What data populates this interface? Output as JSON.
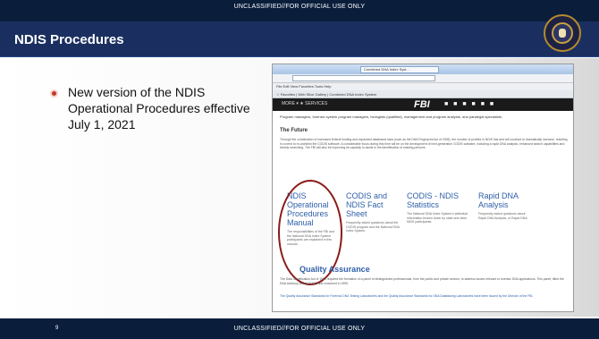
{
  "banner": {
    "classification_top": "UNCLASSIFIED//FOR OFFICIAL USE ONLY",
    "classification_bottom": "UNCLASSIFIED//FOR OFFICIAL USE ONLY"
  },
  "slide": {
    "title": "NDIS Procedures",
    "bullet": "New version of the NDIS Operational Procedures effective July 1, 2021",
    "page_number": "9"
  },
  "screenshot": {
    "browser_tab": "Combined DNA Index Syst...",
    "menu": "File   Edit   View   Favorites   Tools   Help",
    "favorites": "☆  Favorites   |   Web Slice Gallery   |   Combined DNA Index System",
    "fbi_nav": "MORE ▾  ★  SERVICES",
    "fbi_logo": "FBI",
    "fbi_icons": "■ ■ ■ ■ ■ ■",
    "intro_text": "Program managers, forensic system program managers, biologists (qualified), management and program analysts, and paralegal specialists.",
    "future_heading": "The Future",
    "future_text": "Through the combination of increased federal funding and expanded databases laws (such as the DNA Fingerprint Act of 2005), the number of profiles in NDIS has and will continue to dramatically increase, resulting in a need to re-architect the CODIS software. A considerable focus during this time will be on the development of next-generation CODIS software, including a rapid DNA analysis, enhanced search capabilities and kinship searching. The FBI will also be improving its capacity to assist in the identification of missing persons.",
    "links": [
      {
        "title": "NDIS Operational Procedures Manual",
        "desc": "The responsibilities of the FBI and the National DNA Index System participants are explained in this manual."
      },
      {
        "title": "CODIS and NDIS Fact Sheet",
        "desc": "Frequently asked questions about the CODIS program and the National DNA Index System."
      },
      {
        "title": "CODIS - NDIS Statistics",
        "desc": "The National DNA Index System's statistical information broken down by state and other NDIS participants."
      },
      {
        "title": "Rapid DNA Analysis",
        "desc": "Frequently asked questions about Rapid DNA Analysis, or Rapid DNA."
      }
    ],
    "qa_heading": "Quality Assurance",
    "qa_text": "The Data Identification Act of 1994 required the formation of a panel of distinguished professionals, from the public and private sectors, to address issues relevant to forensic DNA applications. This panel, titled the DNA Advisory Board (DAB), first convened in 1995.",
    "qa_links_text": "The Quality Assurance Standards for Forensic DNA Testing Laboratories and the Quality Assurance Standards for DNA Databasing Laboratories have been issued by the Director of the FBI."
  },
  "colors": {
    "banner": "#0a1e3c",
    "header": "#1a2f60",
    "link": "#2e5fa8",
    "circle": "#8b1a1a",
    "bullet": "#c0392b"
  }
}
